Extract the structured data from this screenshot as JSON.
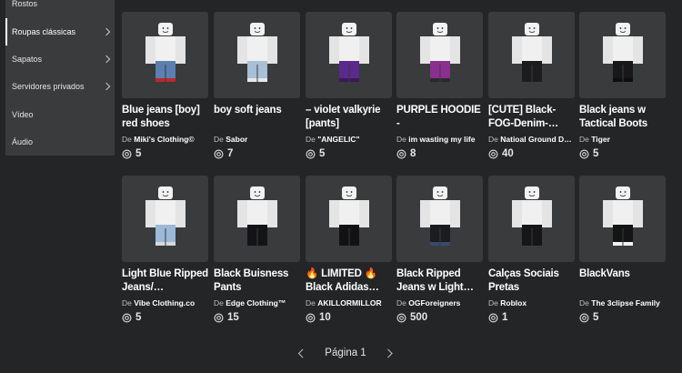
{
  "sidebar": {
    "items": [
      {
        "label": "Rostos",
        "chevron": false,
        "active": false
      },
      {
        "label": "Roupas clássicas",
        "chevron": true,
        "active": true
      },
      {
        "label": "Sapatos",
        "chevron": true,
        "active": false
      },
      {
        "label": "Servidores privados",
        "chevron": true,
        "active": false
      },
      {
        "label": "Vídeo",
        "chevron": false,
        "active": false
      },
      {
        "label": "Áudio",
        "chevron": false,
        "active": false
      }
    ]
  },
  "items": [
    {
      "name": "Blue jeans [boy] red shoes",
      "by": "De",
      "creator": "Miki's Clothing©",
      "price": "5",
      "pants": "#5b7fb0",
      "shoes": "#c0262a"
    },
    {
      "name": "boy soft jeans",
      "by": "De",
      "creator": "Sabor",
      "price": "7",
      "pants": "#a8bfd6",
      "shoes": "#e8e8e8"
    },
    {
      "name": "– violet valkyrie [pants]",
      "by": "De",
      "creator": "\"ANGELIC\"",
      "price": "5",
      "pants": "#5a2a8c",
      "shoes": "#3a1a5a"
    },
    {
      "name": "PURPLE HOODIE -",
      "by": "De",
      "creator": "im wasting my life",
      "price": "8",
      "pants": "#8a2f8e",
      "shoes": "#2a2a2a"
    },
    {
      "name": "[CUTE] Black-FOG-Denim-…",
      "by": "De",
      "creator": "Natioal Ground D…",
      "price": "40",
      "pants": "#1c1c1e",
      "shoes": "#1c1c1e"
    },
    {
      "name": "Black jeans w Tactical Boots",
      "by": "De",
      "creator": "Tiger",
      "price": "5",
      "pants": "#18181a",
      "shoes": "#0e0e0e"
    },
    {
      "name": "Light Blue Ripped Jeans/…",
      "by": "De",
      "creator": "Vibe Clothing.co",
      "price": "5",
      "pants": "#9cb9d8",
      "shoes": "#d8d8d8"
    },
    {
      "name": "Black Buisness Pants",
      "by": "De",
      "creator": "Edge Clothing™",
      "price": "15",
      "pants": "#141416",
      "shoes": "#141416"
    },
    {
      "name": "🔥 LIMITED 🔥 Black Adidas…",
      "by": "De",
      "creator": "AKILLORMILLOR",
      "price": "10",
      "pants": "#121214",
      "shoes": "#121214"
    },
    {
      "name": "Black Ripped Jeans w Light…",
      "by": "De",
      "creator": "OGForeigners",
      "price": "500",
      "pants": "#1a1c20",
      "shoes": "#3a4a6a"
    },
    {
      "name": "Calças Sociais Pretas",
      "by": "De",
      "creator": "Roblox",
      "price": "1",
      "pants": "#161618",
      "shoes": "#161618"
    },
    {
      "name": "BlackVans",
      "by": "De",
      "creator": "The 3clipse Family",
      "price": "5",
      "pants": "#141414",
      "shoes": "#f0f0f0"
    }
  ],
  "pagination": {
    "label": "Página 1"
  },
  "colors": {
    "background": "#232527",
    "card": "#393b3d",
    "sidebar": "#393b3d"
  }
}
